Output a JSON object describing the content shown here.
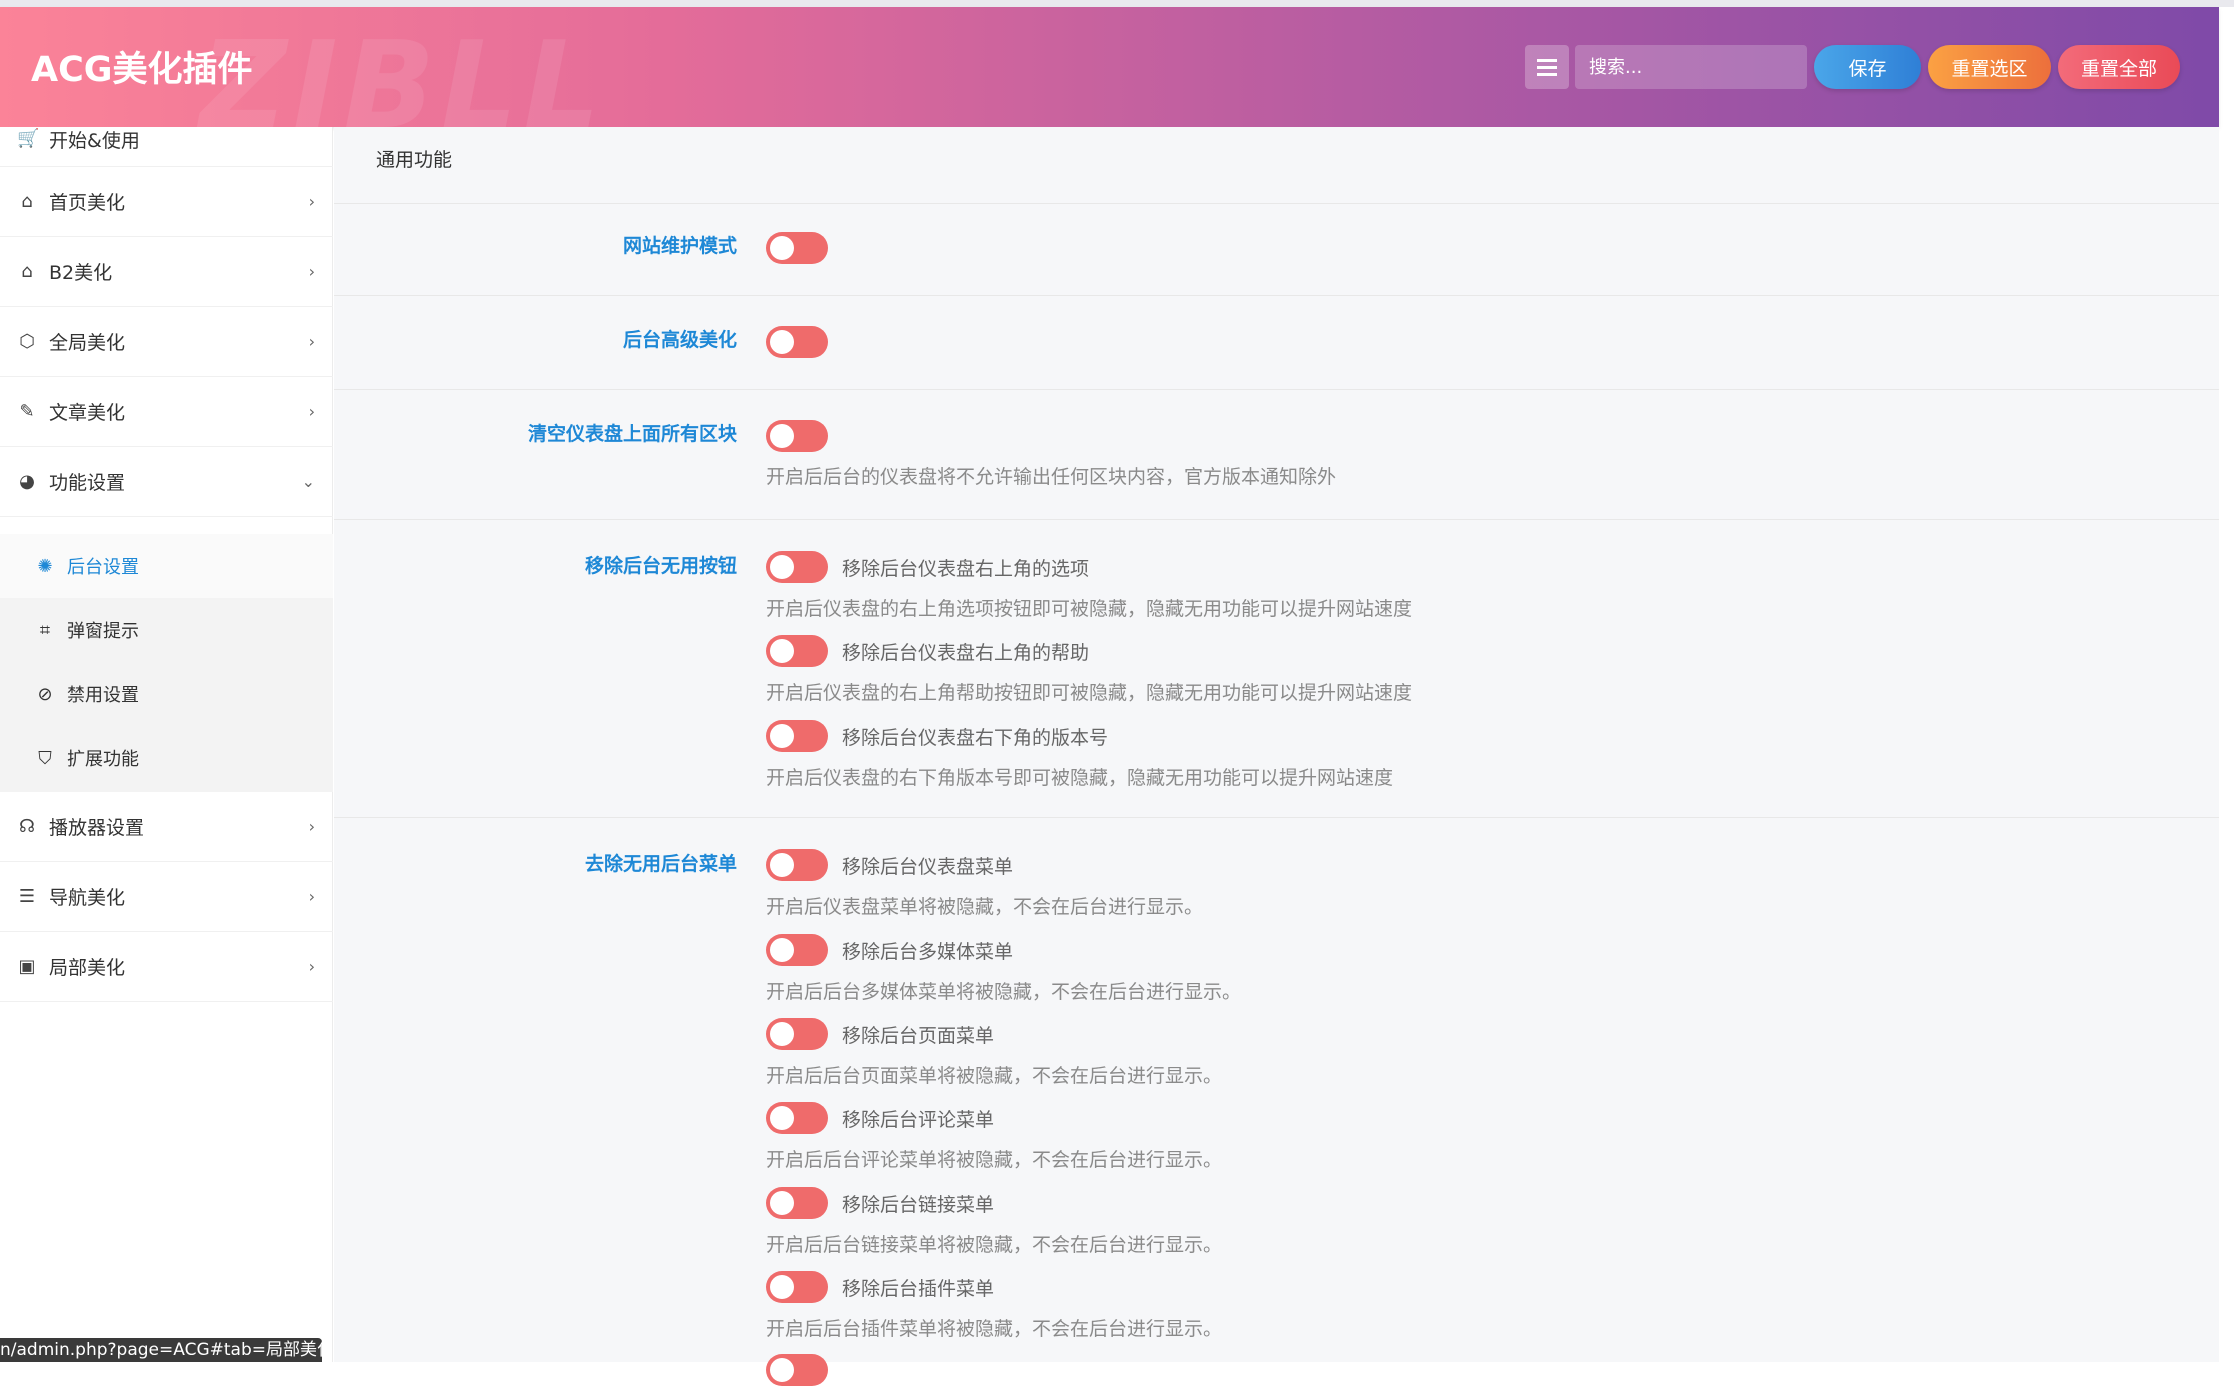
{
  "header": {
    "title": "ACG美化插件",
    "watermark": "ZIBLL",
    "search_placeholder": "搜索...",
    "save_label": "保存",
    "reset_section_label": "重置选区",
    "reset_all_label": "重置全部"
  },
  "sidebar": {
    "items": [
      {
        "label": "开始&使用",
        "icon": "cart-icon",
        "chevron": ""
      },
      {
        "label": "首页美化",
        "icon": "home-icon",
        "chevron": "›"
      },
      {
        "label": "B2美化",
        "icon": "home-icon",
        "chevron": "›"
      },
      {
        "label": "全局美化",
        "icon": "codepen-icon",
        "chevron": "›"
      },
      {
        "label": "文章美化",
        "icon": "edit-icon",
        "chevron": "›"
      },
      {
        "label": "功能设置",
        "icon": "pie-chart-icon",
        "chevron": "⌄"
      }
    ],
    "sub_items": [
      {
        "label": "后台设置",
        "icon": "spinner-icon"
      },
      {
        "label": "弹窗提示",
        "icon": "crop-icon"
      },
      {
        "label": "禁用设置",
        "icon": "ban-icon"
      },
      {
        "label": "扩展功能",
        "icon": "shield-icon"
      }
    ],
    "items_after": [
      {
        "label": "播放器设置",
        "icon": "headphones-icon",
        "chevron": "›"
      },
      {
        "label": "导航美化",
        "icon": "server-icon",
        "chevron": "›"
      },
      {
        "label": "局部美化",
        "icon": "object-group-icon",
        "chevron": "›"
      }
    ]
  },
  "main": {
    "section_title": "通用功能",
    "rows": [
      {
        "label": "网站维护模式"
      },
      {
        "label": "后台高级美化"
      },
      {
        "label": "清空仪表盘上面所有区块",
        "desc": "开启后后台的仪表盘将不允许输出任何区块内容，官方版本通知除外"
      },
      {
        "label": "移除后台无用按钮",
        "options": [
          {
            "label": "移除后台仪表盘右上角的选项",
            "desc": "开启后仪表盘的右上角选项按钮即可被隐藏，隐藏无用功能可以提升网站速度"
          },
          {
            "label": "移除后台仪表盘右上角的帮助",
            "desc": "开启后仪表盘的右上角帮助按钮即可被隐藏，隐藏无用功能可以提升网站速度"
          },
          {
            "label": "移除后台仪表盘右下角的版本号",
            "desc": "开启后仪表盘的右下角版本号即可被隐藏，隐藏无用功能可以提升网站速度"
          }
        ]
      },
      {
        "label": "去除无用后台菜单",
        "options": [
          {
            "label": "移除后台仪表盘菜单",
            "desc": "开启后仪表盘菜单将被隐藏，不会在后台进行显示。"
          },
          {
            "label": "移除后台多媒体菜单",
            "desc": "开启后后台多媒体菜单将被隐藏，不会在后台进行显示。"
          },
          {
            "label": "移除后台页面菜单",
            "desc": "开启后后台页面菜单将被隐藏，不会在后台进行显示。"
          },
          {
            "label": "移除后台评论菜单",
            "desc": "开启后后台评论菜单将被隐藏，不会在后台进行显示。"
          },
          {
            "label": "移除后台链接菜单",
            "desc": "开启后后台链接菜单将被隐藏，不会在后台进行显示。"
          },
          {
            "label": "移除后台插件菜单",
            "desc": "开启后后台插件菜单将被隐藏，不会在后台进行显示。"
          }
        ]
      }
    ]
  },
  "status_url": "n/admin.php?page=ACG#tab=局部美化",
  "colors": {
    "accent": "#1e88d6",
    "toggle": "#ef6b6b"
  }
}
